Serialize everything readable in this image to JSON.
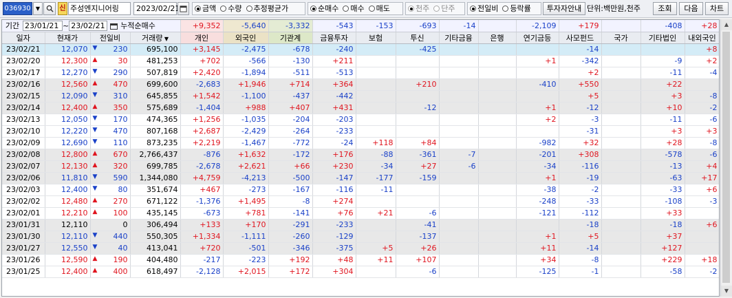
{
  "toolbar": {
    "code": "036930",
    "sin_badge": "신",
    "company": "주성엔지니어링",
    "date": "2023/02/21",
    "radio_group1": [
      {
        "label": "금액",
        "checked": true
      },
      {
        "label": "수량",
        "checked": false
      },
      {
        "label": "추정평균가",
        "checked": false
      }
    ],
    "radio_group2": [
      {
        "label": "순매수",
        "checked": true
      },
      {
        "label": "매수",
        "checked": false
      },
      {
        "label": "매도",
        "checked": false
      }
    ],
    "radio_group3": [
      {
        "label": "천주",
        "checked": true
      },
      {
        "label": "단주",
        "checked": false
      }
    ],
    "radio_group4": [
      {
        "label": "전일비",
        "checked": true
      },
      {
        "label": "등락률",
        "checked": false
      }
    ],
    "guide_button": "투자자안내",
    "unit_label": "단위:백만원,천주",
    "query_button": "조회",
    "next_button": "다음",
    "chart_button": "차트"
  },
  "summary": {
    "label": "기간",
    "from": "23/01/21",
    "sep": "~",
    "to": "23/02/21",
    "cum_label": "누적순매수",
    "values": [
      "+9,352",
      "-5,640",
      "-3,332",
      "-543",
      "-153",
      "-693",
      "-14",
      "",
      "-2,109",
      "+179",
      "",
      "-408",
      "+28"
    ]
  },
  "columns": [
    "일자",
    "현재가",
    "전일비",
    "거래량",
    "개인",
    "외국인",
    "기관계",
    "금융투자",
    "보험",
    "투신",
    "기타금융",
    "은행",
    "연기금등",
    "사모펀드",
    "국가",
    "기타법인",
    "내외국인"
  ],
  "rows": [
    [
      "23/02/21",
      "12,070",
      "dn",
      "230",
      "695,100",
      "+3,145",
      "-2,475",
      "-678",
      "-240",
      "",
      "-425",
      "",
      "",
      "",
      "-14",
      "",
      "",
      "+8"
    ],
    [
      "23/02/20",
      "12,300",
      "up",
      "30",
      "481,253",
      "+702",
      "-566",
      "-130",
      "+211",
      "",
      "",
      "",
      "",
      "+1",
      "-342",
      "",
      "-9",
      "+2"
    ],
    [
      "23/02/17",
      "12,270",
      "dn",
      "290",
      "507,819",
      "+2,420",
      "-1,894",
      "-511",
      "-513",
      "",
      "",
      "",
      "",
      "",
      "+2",
      "",
      "-11",
      "-4"
    ],
    [
      "23/02/16",
      "12,560",
      "up",
      "470",
      "699,600",
      "-2,683",
      "+1,946",
      "+714",
      "+364",
      "",
      "+210",
      "",
      "",
      "-410",
      "+550",
      "",
      "+22",
      ""
    ],
    [
      "23/02/15",
      "12,090",
      "dn",
      "310",
      "645,855",
      "+1,542",
      "-1,100",
      "-437",
      "-442",
      "",
      "",
      "",
      "",
      "",
      "+5",
      "",
      "+3",
      "-8"
    ],
    [
      "23/02/14",
      "12,400",
      "up",
      "350",
      "575,689",
      "-1,404",
      "+988",
      "+407",
      "+431",
      "",
      "-12",
      "",
      "",
      "+1",
      "-12",
      "",
      "+10",
      "-2"
    ],
    [
      "23/02/13",
      "12,050",
      "dn",
      "170",
      "474,365",
      "+1,256",
      "-1,035",
      "-204",
      "-203",
      "",
      "",
      "",
      "",
      "+2",
      "-3",
      "",
      "-11",
      "-6"
    ],
    [
      "23/02/10",
      "12,220",
      "dn",
      "470",
      "807,168",
      "+2,687",
      "-2,429",
      "-264",
      "-233",
      "",
      "",
      "",
      "",
      "",
      "-31",
      "",
      "+3",
      "+3"
    ],
    [
      "23/02/09",
      "12,690",
      "dn",
      "110",
      "873,235",
      "+2,219",
      "-1,467",
      "-772",
      "-24",
      "+118",
      "+84",
      "",
      "",
      "-982",
      "+32",
      "",
      "+28",
      "-8"
    ],
    [
      "23/02/08",
      "12,800",
      "up",
      "670",
      "2,766,437",
      "-876",
      "+1,632",
      "-172",
      "+176",
      "-88",
      "-361",
      "-7",
      "",
      "-201",
      "+308",
      "",
      "-578",
      "-6"
    ],
    [
      "23/02/07",
      "12,130",
      "up",
      "320",
      "699,785",
      "-2,678",
      "+2,621",
      "+66",
      "+230",
      "-34",
      "+27",
      "-6",
      "",
      "-34",
      "-116",
      "",
      "-13",
      "+4"
    ],
    [
      "23/02/06",
      "11,810",
      "dn",
      "590",
      "1,344,080",
      "+4,759",
      "-4,213",
      "-500",
      "-147",
      "-177",
      "-159",
      "",
      "",
      "+1",
      "-19",
      "",
      "-63",
      "+17"
    ],
    [
      "23/02/03",
      "12,400",
      "dn",
      "80",
      "351,674",
      "+467",
      "-273",
      "-167",
      "-116",
      "-11",
      "",
      "",
      "",
      "-38",
      "-2",
      "",
      "-33",
      "+6"
    ],
    [
      "23/02/02",
      "12,480",
      "up",
      "270",
      "671,122",
      "-1,376",
      "+1,495",
      "-8",
      "+274",
      "",
      "",
      "",
      "",
      "-248",
      "-33",
      "",
      "-108",
      "-3"
    ],
    [
      "23/02/01",
      "12,210",
      "up",
      "100",
      "435,145",
      "-673",
      "+781",
      "-141",
      "+76",
      "+21",
      "-6",
      "",
      "",
      "-121",
      "-112",
      "",
      "+33",
      ""
    ],
    [
      "23/01/31",
      "12,110",
      "",
      "0",
      "306,494",
      "+133",
      "+170",
      "-291",
      "-233",
      "",
      "-41",
      "",
      "",
      "",
      "-18",
      "",
      "-18",
      "+6"
    ],
    [
      "23/01/30",
      "12,110",
      "dn",
      "440",
      "550,305",
      "+1,334",
      "-1,111",
      "-260",
      "-129",
      "",
      "-137",
      "",
      "",
      "+1",
      "+5",
      "",
      "+37",
      ""
    ],
    [
      "23/01/27",
      "12,550",
      "dn",
      "40",
      "413,041",
      "+720",
      "-501",
      "-346",
      "-375",
      "+5",
      "+26",
      "",
      "",
      "+11",
      "-14",
      "",
      "+127",
      ""
    ],
    [
      "23/01/26",
      "12,590",
      "up",
      "190",
      "404,480",
      "-217",
      "-223",
      "+192",
      "+48",
      "+11",
      "+107",
      "",
      "",
      "+34",
      "-8",
      "",
      "+229",
      "+18"
    ],
    [
      "23/01/25",
      "12,400",
      "up",
      "400",
      "618,497",
      "-2,128",
      "+2,015",
      "+172",
      "+304",
      "",
      "-6",
      "",
      "",
      "-125",
      "-1",
      "",
      "-58",
      "-2"
    ]
  ],
  "colors": {
    "positive": "#e0141e",
    "negative": "#1940c8",
    "selected_row": "#d4ecf7",
    "shaded_row": "#e8e8e8"
  },
  "icons": {
    "search": "search-icon",
    "calendar": "calendar-icon",
    "dropdown": "chevron-down-icon",
    "up_arrow": "up-triangle-icon",
    "down_arrow": "down-triangle-icon"
  }
}
